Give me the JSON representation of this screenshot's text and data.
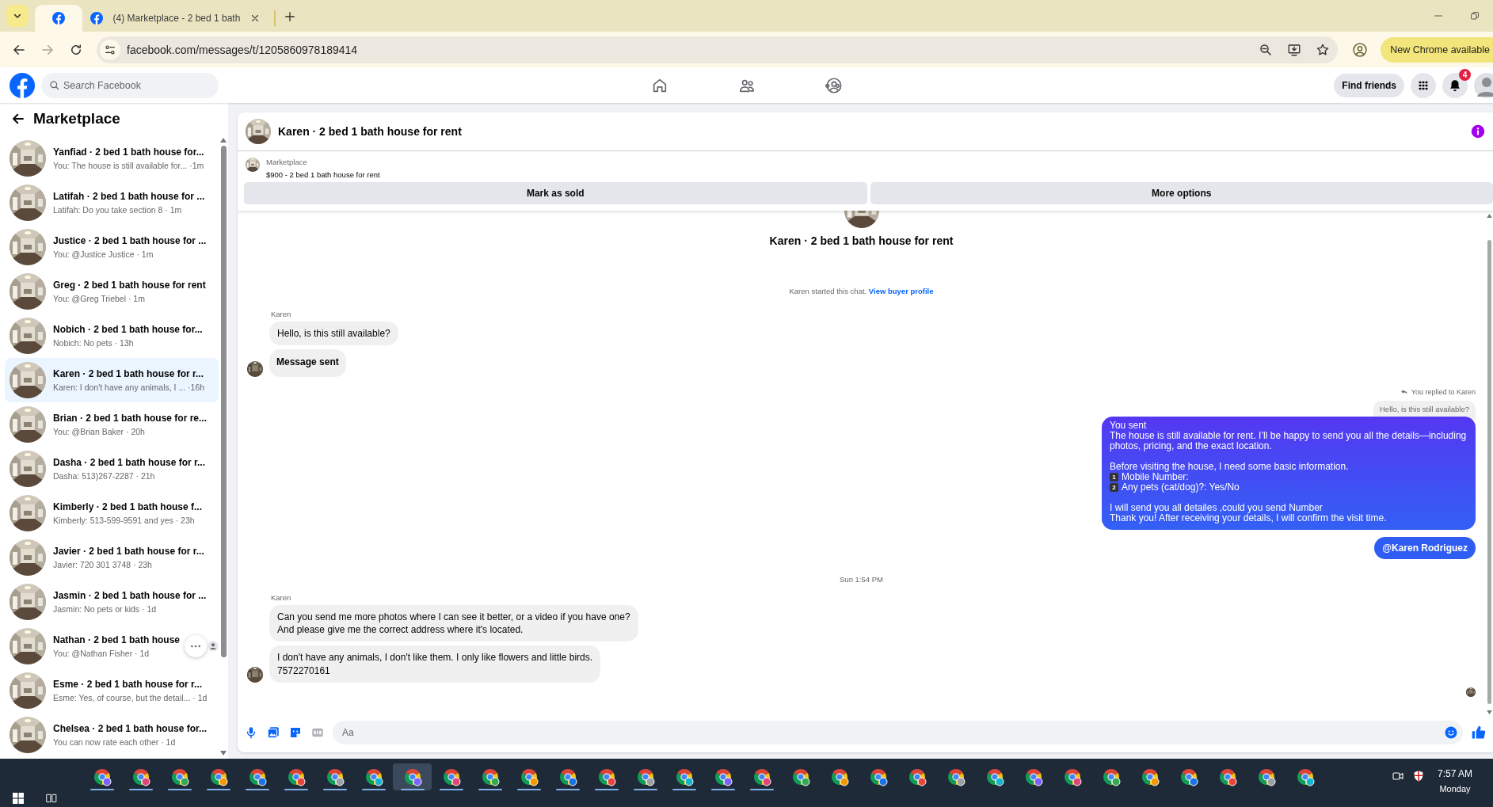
{
  "browser": {
    "tabs": [
      {
        "kind": "pinned",
        "selected": true
      },
      {
        "kind": "page",
        "title": "(4) Marketplace - 2 bed 1 bath",
        "selected": false
      }
    ],
    "forward_disabled": true,
    "address": "facebook.com/messages/t/1205860978189414",
    "update_button": "New Chrome available"
  },
  "facebook": {
    "search_placeholder": "Search Facebook",
    "nav": [
      {
        "kind": "home",
        "selected": false
      },
      {
        "kind": "friends",
        "selected": false
      },
      {
        "kind": "groups",
        "selected": false
      }
    ],
    "find_friends": "Find friends",
    "notification_count": "4"
  },
  "sidebar": {
    "title": "Marketplace",
    "chats": [
      {
        "title": "Yanfiad · 2 bed 1 bath house for...",
        "preview": "You: The house is still available for... ·1m",
        "selected": false,
        "hovered": false
      },
      {
        "title": "Latifah · 2 bed 1 bath house for ...",
        "preview": "Latifah: Do you take section 8 · 1m",
        "selected": false,
        "hovered": false
      },
      {
        "title": "Justice · 2 bed 1 bath house for ...",
        "preview": "You: @Justice Justice · 1m",
        "selected": false,
        "hovered": false
      },
      {
        "title": "Greg · 2 bed 1 bath house for rent",
        "preview": "You: @Greg Triebel · 1m",
        "selected": false,
        "hovered": false
      },
      {
        "title": "Nobich · 2 bed 1 bath house for...",
        "preview": "Nobich: No pets · 13h",
        "selected": false,
        "hovered": false
      },
      {
        "title": "Karen · 2 bed 1 bath house for r...",
        "preview": "Karen: I don't have any animals, I ... ·16h",
        "selected": true,
        "hovered": false
      },
      {
        "title": "Brian · 2 bed 1 bath house for re...",
        "preview": "You: @Brian Baker · 20h",
        "selected": false,
        "hovered": false
      },
      {
        "title": "Dasha · 2 bed 1 bath house for r...",
        "preview": "Dasha: 513)267-2287 · 21h",
        "selected": false,
        "hovered": false
      },
      {
        "title": "Kimberly · 2 bed 1 bath house f...",
        "preview": "Kimberly: 513-599-9591 and yes · 23h",
        "selected": false,
        "hovered": false
      },
      {
        "title": "Javier · 2 bed 1 bath house for r...",
        "preview": "Javier: 720 301 3748 · 23h",
        "selected": false,
        "hovered": false
      },
      {
        "title": "Jasmin · 2 bed 1 bath house for ...",
        "preview": "Jasmin: No pets or kids · 1d",
        "selected": false,
        "hovered": false
      },
      {
        "title": "Nathan · 2 bed 1 bath house",
        "preview": "You: @Nathan Fisher · 1d",
        "selected": false,
        "hovered": true
      },
      {
        "title": "Esme · 2 bed 1 bath house for r...",
        "preview": "Esme: Yes, of course, but the detail... · 1d",
        "selected": false,
        "hovered": false
      },
      {
        "title": "Chelsea · 2 bed 1 bath house for...",
        "preview": "You can now rate each other · 1d",
        "selected": false,
        "hovered": false
      }
    ]
  },
  "chat": {
    "title": "Karen · 2 bed 1 bath house for rent",
    "listing": {
      "source": "Marketplace",
      "summary": "$900 - 2 bed 1 bath house for rent"
    },
    "actions": [
      "Mark as sold",
      "More options"
    ],
    "intro_title": "Karen · 2 bed 1 bath house for rent",
    "started_text": "Karen started this chat.",
    "profile_link": "View buyer profile",
    "messages": [
      {
        "kind": "incoming",
        "sender": "Karen",
        "bubbles": [
          {
            "text": "Hello, is this still available?",
            "emphasis": false
          },
          {
            "text": "Message sent",
            "emphasis": true
          }
        ]
      },
      {
        "kind": "reply",
        "note": "You replied to Karen",
        "quote": "Hello, is this still available?",
        "label": "You sent",
        "blocks": [
          {
            "kind": "line",
            "text": "The house is still available for rent. I’ll be happy to send you all the details—including photos, pricing, and the exact location."
          },
          {
            "kind": "para",
            "text": "Before visiting the house, I need some basic information."
          },
          {
            "kind": "item",
            "badge": "1",
            "text": "Mobile Number:"
          },
          {
            "kind": "item",
            "badge": "2",
            "text": "Any pets (cat/dog)?: Yes/No"
          },
          {
            "kind": "para",
            "text": "I will send you all detailes ,could you send Number"
          },
          {
            "kind": "line",
            "text": "Thank you! After receiving your details, I will confirm the visit time."
          }
        ]
      },
      {
        "kind": "outgoing",
        "text": "@Karen Rodriguez"
      },
      {
        "kind": "timestamp",
        "text": "Sun 1:54 PM"
      },
      {
        "kind": "incoming",
        "sender": "Karen",
        "bubbles": [
          {
            "text": "Can you send me more photos where I can see it better, or a video if you have one?\nAnd please give me the correct address where it's located.",
            "emphasis": false
          },
          {
            "text": "I don't have any animals, I don't like them. I only like flowers and little birds.\n7572270161",
            "emphasis": false
          }
        ]
      }
    ],
    "composer_placeholder": "Aa"
  },
  "taskbar": {
    "apps": [
      {
        "running": true,
        "selected": false
      },
      {
        "running": true,
        "selected": false
      },
      {
        "running": true,
        "selected": false
      },
      {
        "running": true,
        "selected": false
      },
      {
        "running": true,
        "selected": false
      },
      {
        "running": true,
        "selected": false
      },
      {
        "running": true,
        "selected": false
      },
      {
        "running": true,
        "selected": false
      },
      {
        "running": true,
        "selected": true
      },
      {
        "running": true,
        "selected": false
      },
      {
        "running": true,
        "selected": false
      },
      {
        "running": true,
        "selected": false
      },
      {
        "running": true,
        "selected": false
      },
      {
        "running": true,
        "selected": false
      },
      {
        "running": true,
        "selected": false
      },
      {
        "running": true,
        "selected": false
      },
      {
        "running": true,
        "selected": false
      },
      {
        "running": true,
        "selected": false
      },
      {
        "running": false,
        "selected": false
      },
      {
        "running": false,
        "selected": false
      },
      {
        "running": false,
        "selected": false
      },
      {
        "running": false,
        "selected": false
      },
      {
        "running": false,
        "selected": false
      },
      {
        "running": false,
        "selected": false
      },
      {
        "running": false,
        "selected": false
      },
      {
        "running": false,
        "selected": false
      },
      {
        "running": false,
        "selected": false
      },
      {
        "running": false,
        "selected": false
      },
      {
        "running": false,
        "selected": false
      },
      {
        "running": false,
        "selected": false
      },
      {
        "running": false,
        "selected": false
      },
      {
        "running": false,
        "selected": false
      }
    ],
    "time": "7:57 AM",
    "date": "Monday"
  }
}
